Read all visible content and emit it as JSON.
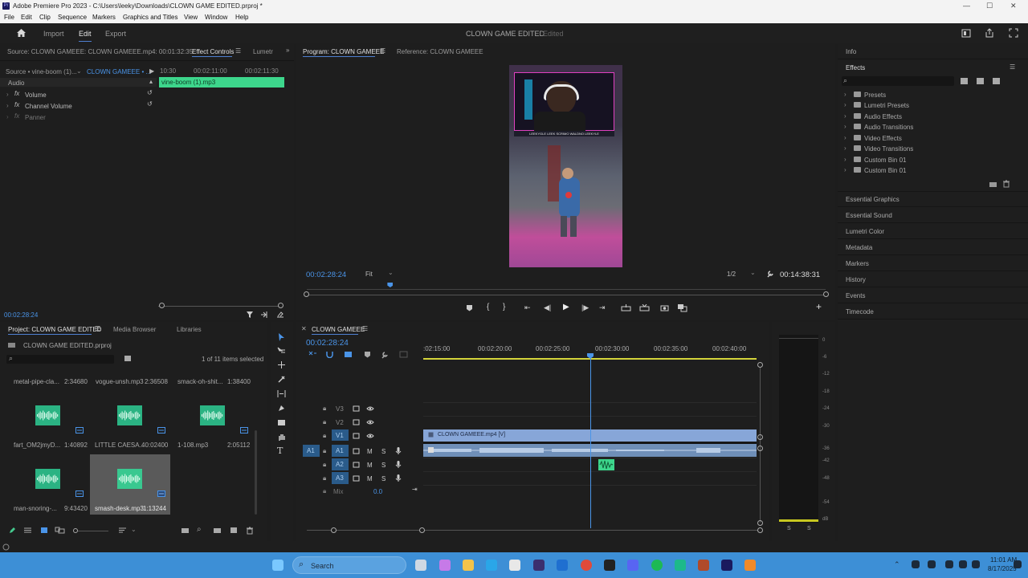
{
  "window": {
    "title": "Adobe Premiere Pro 2023 - C:\\Users\\leeky\\Downloads\\CLOWN GAME EDITED.prproj *",
    "minimize": "—",
    "maximize": "☐",
    "close": "✕",
    "app_icon": "Pr"
  },
  "menu": [
    "File",
    "Edit",
    "Clip",
    "Sequence",
    "Markers",
    "Graphics and Titles",
    "View",
    "Window",
    "Help"
  ],
  "header": {
    "workspaces": [
      "Import",
      "Edit",
      "Export"
    ],
    "active_workspace": "Edit",
    "project_title": "CLOWN GAME EDITED",
    "project_status": "Edited"
  },
  "source_panel": {
    "tabs": [
      "Source: CLOWN GAMEEE: CLOWN GAMEEE.mp4: 00:01:32:35",
      "Effect Controls",
      "Lumetr"
    ],
    "clip_selector": "Source • vine-boom (1)...",
    "sequence_selector": "CLOWN GAMEEE • ...",
    "ruler": [
      "10:30",
      "00:02:11:00",
      "00:02:11:30"
    ],
    "clip_bar": "vine-boom (1).mp3",
    "section": "Audio",
    "effects": [
      "Volume",
      "Channel Volume",
      "Panner"
    ],
    "fx": "fx",
    "timecode": "00:02:28:24"
  },
  "program_monitor": {
    "tabs": [
      "Program: CLOWN GAMEEE",
      "Reference: CLOWN GAMEEE"
    ],
    "timecode": "00:02:28:24",
    "fit": "Fit",
    "resolution": "1/2",
    "duration": "00:14:38:31",
    "overlay_names": "LEEKYGLE LEEK SCRIMO WALDNO LEEKYLE",
    "video_playhead_fraction": 0.16
  },
  "right_panel": {
    "top_tab": "Info",
    "effects_title": "Effects",
    "folders": [
      "Presets",
      "Lumetri Presets",
      "Audio Effects",
      "Audio Transitions",
      "Video Effects",
      "Video Transitions",
      "Custom Bin 01",
      "Custom Bin 01"
    ],
    "sections": [
      "Essential Graphics",
      "Essential Sound",
      "Lumetri Color",
      "Metadata",
      "Markers",
      "History",
      "Events",
      "Timecode"
    ]
  },
  "project_panel": {
    "tabs": [
      "Project: CLOWN GAME EDITED",
      "Media Browser",
      "Libraries"
    ],
    "project_file": "CLOWN GAME EDITED.prproj",
    "selection_count": "1 of 11 items selected",
    "items_row0": [
      {
        "name": "metal-pipe-cla...",
        "duration": "2:34680"
      },
      {
        "name": "vogue-unsh.mp3",
        "duration": "2:36508"
      },
      {
        "name": "smack-oh-shit...",
        "duration": "1:38400"
      }
    ],
    "items_row1": [
      {
        "name": "fart_OM2jmyD...",
        "duration": "1:40892"
      },
      {
        "name": "LITTLE CAESA...",
        "duration": "40:02400"
      },
      {
        "name": "1-108.mp3",
        "duration": "2:05112"
      }
    ],
    "items_row2": [
      {
        "name": "man-snoring-...",
        "duration": "9:43420"
      },
      {
        "name": "smash-desk.mp3",
        "duration": "1:13244"
      }
    ]
  },
  "timeline": {
    "tab": "CLOWN GAMEEE",
    "timecode": "00:02:28:24",
    "ruler": [
      ":02:15:00",
      "00:02:20:00",
      "00:02:25:00",
      "00:02:30:00",
      "00:02:35:00",
      "00:02:40:00"
    ],
    "video_tracks": [
      "V3",
      "V2",
      "V1"
    ],
    "audio_tracks": [
      "A1",
      "A2",
      "A3"
    ],
    "source_patch": "A1",
    "mix_label": "Mix",
    "mix_value": "0.0",
    "video_clip": "CLOWN GAMEEE.mp4 [V]",
    "m": "M",
    "s": "S"
  },
  "meters": {
    "scale": [
      "0",
      "-6",
      "-12",
      "-18",
      "-24",
      "-30",
      "-36",
      "-42",
      "-48",
      "-54",
      "dB"
    ],
    "solo": [
      "S",
      "S"
    ]
  },
  "taskbar": {
    "search": "Search",
    "time": "11:01 AM",
    "date": "8/17/2025"
  }
}
